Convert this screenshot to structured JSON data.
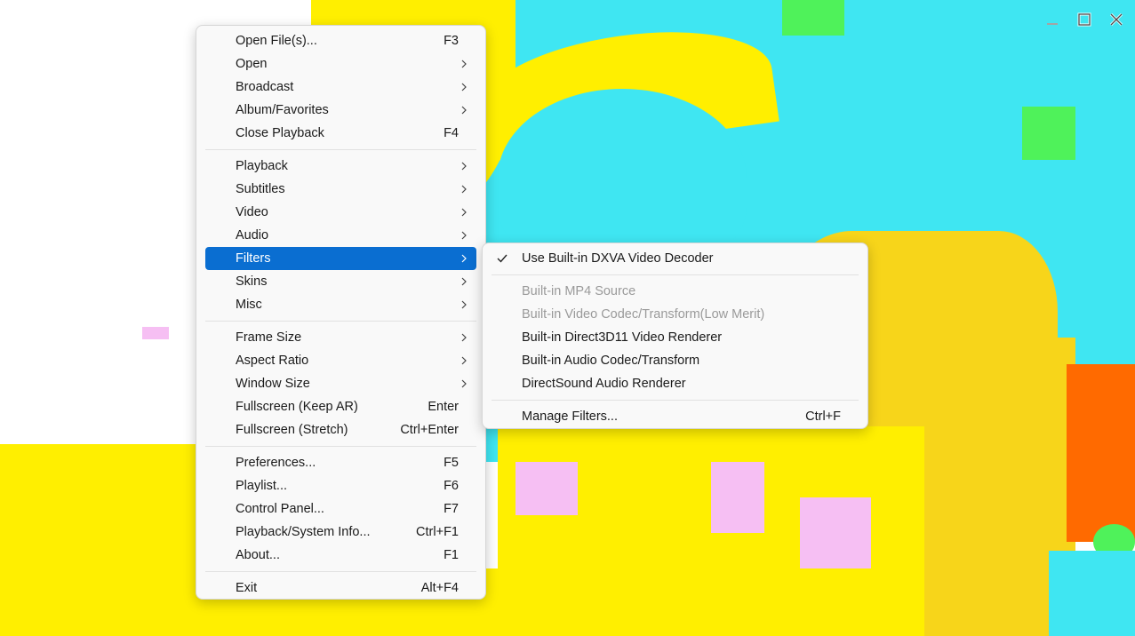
{
  "colors": {
    "menu_bg": "#f9f9f9",
    "highlight": "#0a6ed1",
    "disabled_text": "#9a9a9a"
  },
  "window_controls": {
    "minimize_icon": "minimize-icon",
    "maximize_icon": "maximize-icon",
    "close_icon": "close-icon"
  },
  "main_menu": {
    "items": [
      {
        "label": "Open File(s)...",
        "accel": "F3"
      },
      {
        "label": "Open",
        "submenu": true
      },
      {
        "label": "Broadcast",
        "submenu": true
      },
      {
        "label": "Album/Favorites",
        "submenu": true
      },
      {
        "label": "Close Playback",
        "accel": "F4"
      },
      {
        "label": "Playback",
        "submenu": true
      },
      {
        "label": "Subtitles",
        "submenu": true
      },
      {
        "label": "Video",
        "submenu": true
      },
      {
        "label": "Audio",
        "submenu": true
      },
      {
        "label": "Filters",
        "submenu": true,
        "active": true
      },
      {
        "label": "Skins",
        "submenu": true
      },
      {
        "label": "Misc",
        "submenu": true
      },
      {
        "label": "Frame Size",
        "submenu": true
      },
      {
        "label": "Aspect Ratio",
        "submenu": true
      },
      {
        "label": "Window Size",
        "submenu": true
      },
      {
        "label": "Fullscreen (Keep AR)",
        "accel": "Enter"
      },
      {
        "label": "Fullscreen (Stretch)",
        "accel": "Ctrl+Enter"
      },
      {
        "label": "Preferences...",
        "accel": "F5"
      },
      {
        "label": "Playlist...",
        "accel": "F6"
      },
      {
        "label": "Control Panel...",
        "accel": "F7"
      },
      {
        "label": "Playback/System Info...",
        "accel": "Ctrl+F1"
      },
      {
        "label": "About...",
        "accel": "F1"
      },
      {
        "label": "Exit",
        "accel": "Alt+F4"
      }
    ]
  },
  "filters_submenu": {
    "items": [
      {
        "label": "Use Built-in DXVA Video Decoder",
        "checked": true
      },
      {
        "label": "Built-in MP4 Source",
        "disabled": true
      },
      {
        "label": "Built-in Video Codec/Transform(Low Merit)",
        "disabled": true
      },
      {
        "label": "Built-in Direct3D11 Video Renderer"
      },
      {
        "label": "Built-in Audio Codec/Transform"
      },
      {
        "label": "DirectSound Audio Renderer"
      },
      {
        "label": "Manage Filters...",
        "accel": "Ctrl+F"
      }
    ]
  }
}
